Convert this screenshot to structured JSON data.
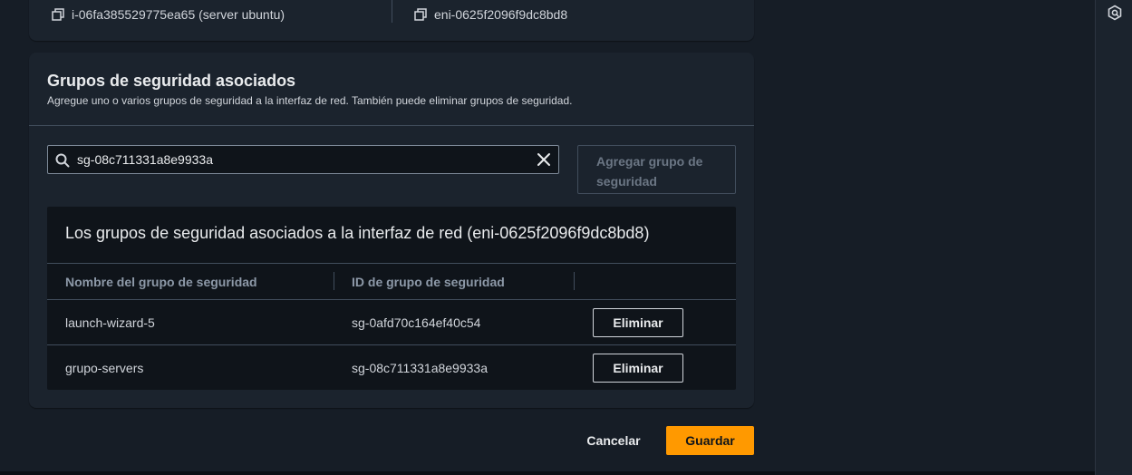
{
  "summary": {
    "instance": "i-06fa385529775ea65 (server ubuntu)",
    "interface": "eni-0625f2096f9dc8bd8"
  },
  "section": {
    "title": "Grupos de seguridad asociados",
    "description": "Agregue uno o varios grupos de seguridad a la interfaz de red. También puede eliminar grupos de seguridad."
  },
  "search": {
    "value": "sg-08c711331a8e9933a",
    "placeholder": ""
  },
  "add_button": {
    "line1": "Agregar grupo de",
    "line2": "seguridad"
  },
  "table": {
    "title": "Los grupos de seguridad asociados a la interfaz de red (eni-0625f2096f9dc8bd8)",
    "columns": [
      "Nombre del grupo de seguridad",
      "ID de grupo de seguridad"
    ],
    "rows": [
      {
        "name": "launch-wizard-5",
        "id": "sg-0afd70c164ef40c54",
        "action": "Eliminar"
      },
      {
        "name": "grupo-servers",
        "id": "sg-08c711331a8e9933a",
        "action": "Eliminar"
      }
    ]
  },
  "footer": {
    "cancel": "Cancelar",
    "save": "Guardar"
  },
  "colors": {
    "accent": "#ff9900",
    "background": "#161d26",
    "card": "#1b232d"
  },
  "icons": [
    "copy-icon",
    "search-icon",
    "clear-icon",
    "side-panel-icon"
  ]
}
